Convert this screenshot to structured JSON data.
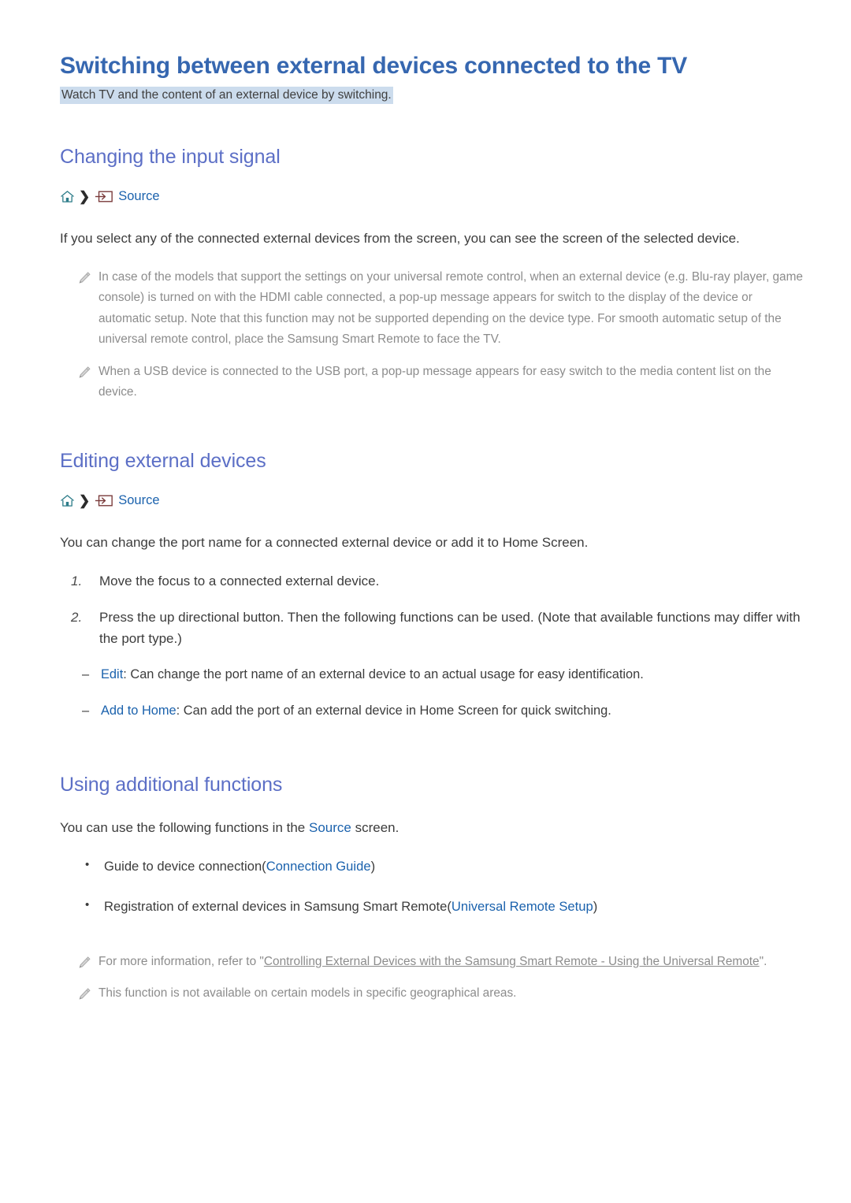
{
  "document": {
    "title": "Switching between external devices connected to the TV",
    "subtitle": "Watch TV and the content of an external device by switching."
  },
  "icons": {
    "home": "home-icon",
    "chevron": "❯",
    "source": "source-input-icon",
    "pencil": "pencil-note-icon",
    "bullet": "•",
    "dash": "–"
  },
  "colors": {
    "title": "#3667b0",
    "heading": "#5c6fc6",
    "link": "#1b62ad",
    "body": "#3c3c3c",
    "note": "#8c8c8c",
    "highlight": "#ccdced",
    "home_icon": "#2e7d8a",
    "source_icon": "#7a3b3b"
  },
  "sections": [
    {
      "heading": "Changing the input signal",
      "breadcrumb": {
        "label": "Source"
      },
      "paragraph": "If you select any of the connected external devices from the screen, you can see the screen of the selected device.",
      "notes": [
        "In case of the models that support the settings on your universal remote control, when an external device (e.g. Blu-ray player, game console) is turned on with the HDMI cable connected, a pop-up message appears for switch to the display of the device or automatic setup. Note that this function may not be supported depending on the device type. For smooth automatic setup of the universal remote control, place the Samsung Smart Remote to face the TV.",
        "When a USB device is connected to the USB port, a pop-up message appears for easy switch to the media content list on the device."
      ]
    },
    {
      "heading": "Editing external devices",
      "breadcrumb": {
        "label": "Source"
      },
      "paragraph": "You can change the port name for a connected external device or add it to Home Screen.",
      "steps": [
        "Move the focus to a connected external device.",
        "Press the up directional button. Then the following functions can be used. (Note that available functions may differ with the port type.)"
      ],
      "sub_items": [
        {
          "link": "Edit",
          "text": ": Can change the port name of an external device to an actual usage for easy identification."
        },
        {
          "link": "Add to Home",
          "text": ": Can add the port of an external device in Home Screen for quick switching."
        }
      ]
    },
    {
      "heading": "Using additional functions",
      "intro_before": "You can use the following functions in the ",
      "intro_link": "Source",
      "intro_after": " screen.",
      "bullets": [
        {
          "text": "Guide to device connection(",
          "link": "Connection Guide",
          "tail": ")"
        },
        {
          "text": "Registration of external devices in Samsung Smart Remote(",
          "link": "Universal Remote Setup",
          "tail": ")"
        }
      ],
      "notes": [
        {
          "before": "For more information, refer to \"",
          "link": "Controlling External Devices with the Samsung Smart Remote - Using the Universal Remote",
          "after": "\"."
        },
        {
          "plain": "This function is not available on certain models in specific geographical areas."
        }
      ]
    }
  ]
}
